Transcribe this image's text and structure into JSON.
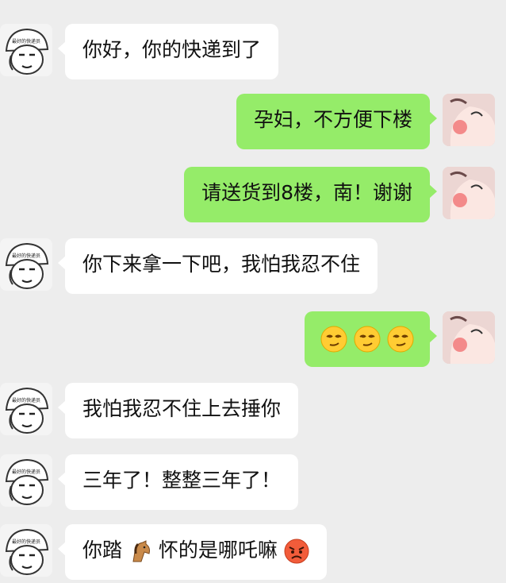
{
  "messages": [
    {
      "side": "in",
      "text": "你好，你的快递到了"
    },
    {
      "side": "out",
      "text": "孕妇，不方便下楼"
    },
    {
      "side": "out",
      "text": "请送货到8楼，南！谢谢"
    },
    {
      "side": "in",
      "text": "你下来拿一下吧，我怕我忍不住"
    },
    {
      "side": "out",
      "emoji": [
        "smirk-face-icon",
        "smirk-face-icon",
        "smirk-face-icon"
      ]
    },
    {
      "side": "in",
      "text": "我怕我忍不住上去捶你"
    },
    {
      "side": "in",
      "text": "三年了！整整三年了！"
    },
    {
      "side": "in",
      "text_before": "你踏",
      "inline_icon": "horse-icon",
      "text_after": "怀的是哪吒嘛",
      "trailing_icon": "angry-face-icon"
    }
  ],
  "courier_avatar": {
    "helmet_text": "最好的快递员"
  },
  "colors": {
    "background": "#ededed",
    "incoming_bubble": "#ffffff",
    "outgoing_bubble": "#95ec69"
  }
}
